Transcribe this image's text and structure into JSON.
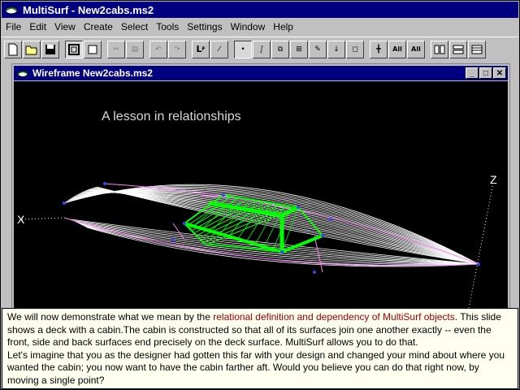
{
  "window": {
    "title": "MultiSurf - New2cabs.ms2"
  },
  "menu": {
    "items": [
      "File",
      "Edit",
      "View",
      "Create",
      "Select",
      "Tools",
      "Settings",
      "Window",
      "Help"
    ]
  },
  "toolbar": {
    "buttons": [
      "new-icon",
      "open-icon",
      "save-icon",
      "frame-icon",
      "square-icon",
      "cut-icon",
      "calc-icon",
      "undo-icon",
      "redo-icon",
      "L",
      "pointer-icon",
      "point-icon",
      "curve-icon",
      "surface-icon",
      "grid-icon",
      "edit-icon",
      "move-icon",
      "select-box-icon",
      "snap-icon",
      "All",
      "All",
      "tile-vertical-icon",
      "tile-horizontal-icon",
      "cascade-icon"
    ]
  },
  "child_window": {
    "title": "Wireframe New2cabs.ms2",
    "caption": "A lesson in relationships",
    "axis_x": "X",
    "axis_z": "Z",
    "colors": {
      "background": "#000000",
      "hull_lines": "#ffffff",
      "cabin": "#00ff00",
      "control_points": "#4040ff",
      "accent_lines": "#ff80ff"
    }
  },
  "tip": {
    "part1": "We will now demonstrate what we mean by the ",
    "highlight": "relational definition and dependency of MultiSurf objects",
    "part2": ". This slide shows a deck with a cabin.The cabin is constructed so that all of its surfaces join one another exactly -- even the front, side and back surfaces end precisely on the deck surface. MultiSurf allows you to do that.",
    "part3": "Let's imagine that you as the designer had gotten this far with your design and changed your mind about where you wanted the cabin; you now want to have the cabin farther aft. Would you believe you can do that right now, by moving a single point?"
  }
}
